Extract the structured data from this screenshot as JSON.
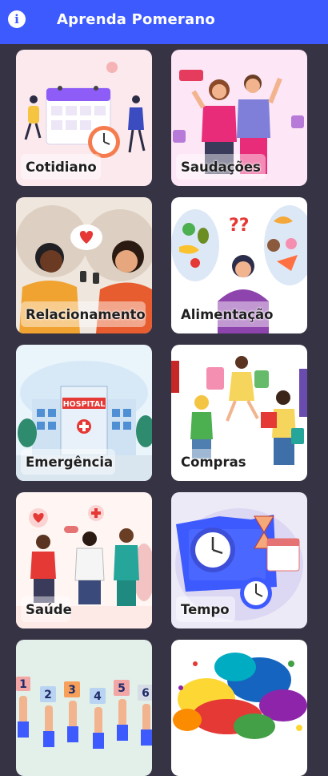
{
  "app": {
    "title": "Aprenda Pomerano",
    "info_icon": "info-icon"
  },
  "categories": [
    {
      "label": "Cotidiano",
      "icon": "daily-routine-illustration",
      "bg": "#fbe9ee"
    },
    {
      "label": "Saudações",
      "icon": "greetings-illustration",
      "bg": "#fde6f5"
    },
    {
      "label": "Relacionamento",
      "icon": "relationship-illustration",
      "bg": "#efe6dd"
    },
    {
      "label": "Alimentação",
      "icon": "food-illustration",
      "bg": "#ffffff"
    },
    {
      "label": "Emergência",
      "icon": "hospital-illustration",
      "bg": "#eaf4fb"
    },
    {
      "label": "Compras",
      "icon": "shopping-illustration",
      "bg": "#ffffff"
    },
    {
      "label": "Saúde",
      "icon": "health-illustration",
      "bg": "#fff6f4"
    },
    {
      "label": "Tempo",
      "icon": "time-illustration",
      "bg": "#eceaf7"
    },
    {
      "label": "",
      "icon": "numbers-illustration",
      "bg": "#e3efe9"
    },
    {
      "label": "",
      "icon": "colors-illustration",
      "bg": "#ffffff"
    }
  ],
  "colors": {
    "appbar": "#3d5afe",
    "background": "#363345"
  }
}
